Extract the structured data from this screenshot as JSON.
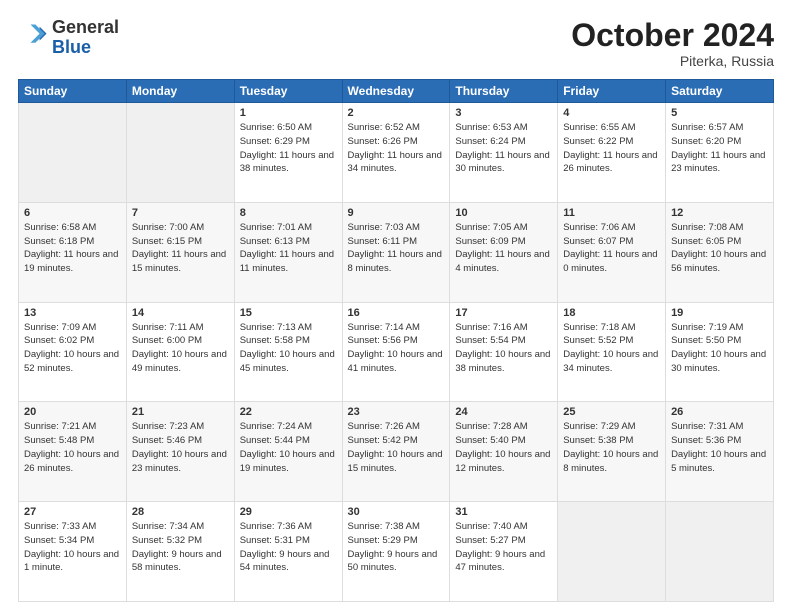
{
  "header": {
    "logo_line1": "General",
    "logo_line2": "Blue",
    "month": "October 2024",
    "location": "Piterka, Russia"
  },
  "weekdays": [
    "Sunday",
    "Monday",
    "Tuesday",
    "Wednesday",
    "Thursday",
    "Friday",
    "Saturday"
  ],
  "weeks": [
    [
      {
        "day": "",
        "info": ""
      },
      {
        "day": "",
        "info": ""
      },
      {
        "day": "1",
        "info": "Sunrise: 6:50 AM\nSunset: 6:29 PM\nDaylight: 11 hours and 38 minutes."
      },
      {
        "day": "2",
        "info": "Sunrise: 6:52 AM\nSunset: 6:26 PM\nDaylight: 11 hours and 34 minutes."
      },
      {
        "day": "3",
        "info": "Sunrise: 6:53 AM\nSunset: 6:24 PM\nDaylight: 11 hours and 30 minutes."
      },
      {
        "day": "4",
        "info": "Sunrise: 6:55 AM\nSunset: 6:22 PM\nDaylight: 11 hours and 26 minutes."
      },
      {
        "day": "5",
        "info": "Sunrise: 6:57 AM\nSunset: 6:20 PM\nDaylight: 11 hours and 23 minutes."
      }
    ],
    [
      {
        "day": "6",
        "info": "Sunrise: 6:58 AM\nSunset: 6:18 PM\nDaylight: 11 hours and 19 minutes."
      },
      {
        "day": "7",
        "info": "Sunrise: 7:00 AM\nSunset: 6:15 PM\nDaylight: 11 hours and 15 minutes."
      },
      {
        "day": "8",
        "info": "Sunrise: 7:01 AM\nSunset: 6:13 PM\nDaylight: 11 hours and 11 minutes."
      },
      {
        "day": "9",
        "info": "Sunrise: 7:03 AM\nSunset: 6:11 PM\nDaylight: 11 hours and 8 minutes."
      },
      {
        "day": "10",
        "info": "Sunrise: 7:05 AM\nSunset: 6:09 PM\nDaylight: 11 hours and 4 minutes."
      },
      {
        "day": "11",
        "info": "Sunrise: 7:06 AM\nSunset: 6:07 PM\nDaylight: 11 hours and 0 minutes."
      },
      {
        "day": "12",
        "info": "Sunrise: 7:08 AM\nSunset: 6:05 PM\nDaylight: 10 hours and 56 minutes."
      }
    ],
    [
      {
        "day": "13",
        "info": "Sunrise: 7:09 AM\nSunset: 6:02 PM\nDaylight: 10 hours and 52 minutes."
      },
      {
        "day": "14",
        "info": "Sunrise: 7:11 AM\nSunset: 6:00 PM\nDaylight: 10 hours and 49 minutes."
      },
      {
        "day": "15",
        "info": "Sunrise: 7:13 AM\nSunset: 5:58 PM\nDaylight: 10 hours and 45 minutes."
      },
      {
        "day": "16",
        "info": "Sunrise: 7:14 AM\nSunset: 5:56 PM\nDaylight: 10 hours and 41 minutes."
      },
      {
        "day": "17",
        "info": "Sunrise: 7:16 AM\nSunset: 5:54 PM\nDaylight: 10 hours and 38 minutes."
      },
      {
        "day": "18",
        "info": "Sunrise: 7:18 AM\nSunset: 5:52 PM\nDaylight: 10 hours and 34 minutes."
      },
      {
        "day": "19",
        "info": "Sunrise: 7:19 AM\nSunset: 5:50 PM\nDaylight: 10 hours and 30 minutes."
      }
    ],
    [
      {
        "day": "20",
        "info": "Sunrise: 7:21 AM\nSunset: 5:48 PM\nDaylight: 10 hours and 26 minutes."
      },
      {
        "day": "21",
        "info": "Sunrise: 7:23 AM\nSunset: 5:46 PM\nDaylight: 10 hours and 23 minutes."
      },
      {
        "day": "22",
        "info": "Sunrise: 7:24 AM\nSunset: 5:44 PM\nDaylight: 10 hours and 19 minutes."
      },
      {
        "day": "23",
        "info": "Sunrise: 7:26 AM\nSunset: 5:42 PM\nDaylight: 10 hours and 15 minutes."
      },
      {
        "day": "24",
        "info": "Sunrise: 7:28 AM\nSunset: 5:40 PM\nDaylight: 10 hours and 12 minutes."
      },
      {
        "day": "25",
        "info": "Sunrise: 7:29 AM\nSunset: 5:38 PM\nDaylight: 10 hours and 8 minutes."
      },
      {
        "day": "26",
        "info": "Sunrise: 7:31 AM\nSunset: 5:36 PM\nDaylight: 10 hours and 5 minutes."
      }
    ],
    [
      {
        "day": "27",
        "info": "Sunrise: 7:33 AM\nSunset: 5:34 PM\nDaylight: 10 hours and 1 minute."
      },
      {
        "day": "28",
        "info": "Sunrise: 7:34 AM\nSunset: 5:32 PM\nDaylight: 9 hours and 58 minutes."
      },
      {
        "day": "29",
        "info": "Sunrise: 7:36 AM\nSunset: 5:31 PM\nDaylight: 9 hours and 54 minutes."
      },
      {
        "day": "30",
        "info": "Sunrise: 7:38 AM\nSunset: 5:29 PM\nDaylight: 9 hours and 50 minutes."
      },
      {
        "day": "31",
        "info": "Sunrise: 7:40 AM\nSunset: 5:27 PM\nDaylight: 9 hours and 47 minutes."
      },
      {
        "day": "",
        "info": ""
      },
      {
        "day": "",
        "info": ""
      }
    ]
  ]
}
